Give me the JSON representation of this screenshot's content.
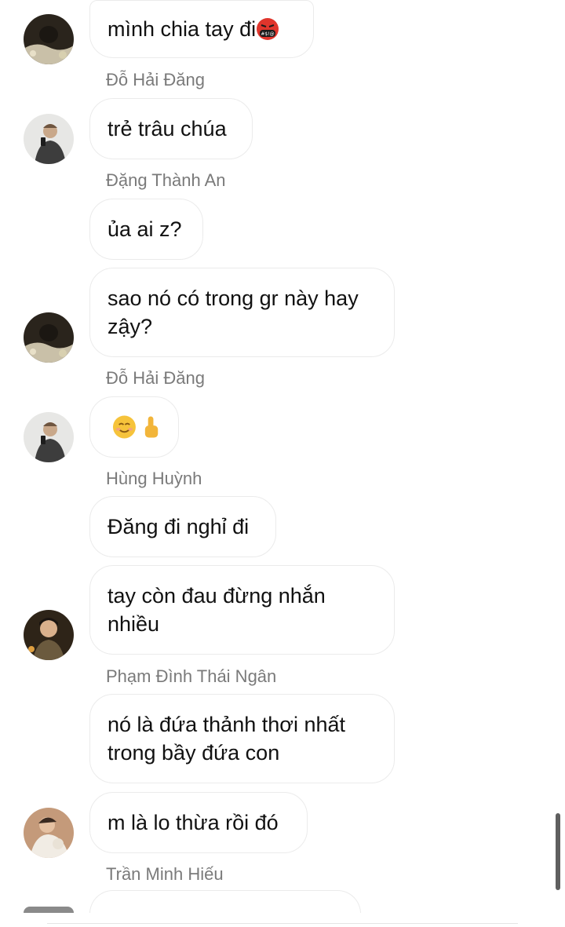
{
  "messages": [
    {
      "text": "mình chia tay đi"
    },
    {
      "text": "trẻ trâu chúa"
    },
    {
      "text": "ủa ai z?"
    },
    {
      "text": "sao nó có trong gr này hay\nzậy?"
    },
    {
      "text": ""
    },
    {
      "text": "Đăng đi nghỉ đi"
    },
    {
      "text": "tay còn đau đừng nhắn\nnhiều"
    },
    {
      "text": "nó là đứa thảnh thơi nhất\ntrong bầy đứa con"
    },
    {
      "text": "m là lo thừa rồi đó"
    }
  ],
  "senders": [
    "Đỗ Hải Đăng",
    "Đặng Thành An",
    "Đỗ Hải Đăng",
    "Hùng Huỳnh",
    "Phạm Đình Thái Ngân",
    "Trần Minh Hiếu"
  ],
  "emojis": {
    "angry_face": "swearing-face-icon",
    "smiling_face": "smiling-face-icon",
    "pointing": "index-pointing-up-icon"
  },
  "colors": {
    "bubble_border": "#ebebeb",
    "sender_name": "#7a7a7a",
    "background": "#ffffff"
  }
}
